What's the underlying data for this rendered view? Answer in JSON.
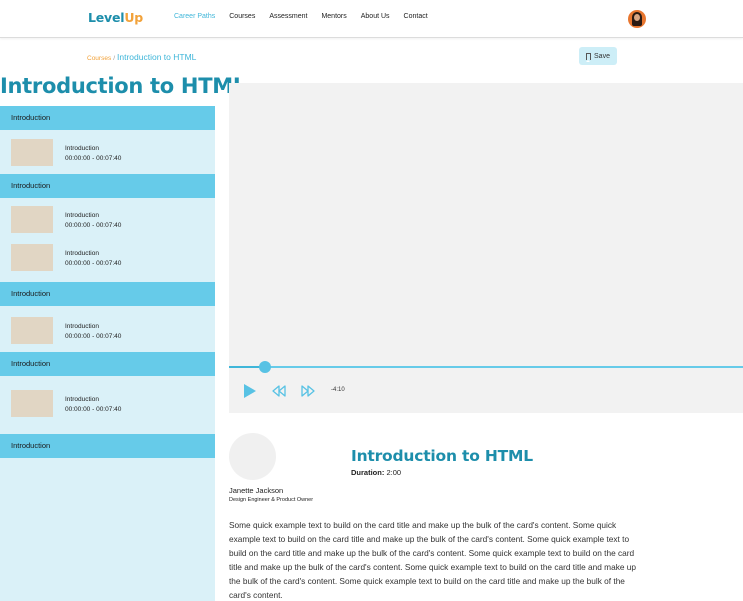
{
  "header": {
    "logo_part1": "Level",
    "logo_part2": "Up",
    "nav": [
      "Career Paths",
      "Courses",
      "Assessment",
      "Mentors",
      "About Us",
      "Contact"
    ],
    "active_nav": "Career Paths"
  },
  "breadcrumb": {
    "root": "Courses",
    "separator": "/",
    "current": "Introduction to HTML"
  },
  "save_label": "Save",
  "page_title": "Introduction to HTML",
  "sidebar": {
    "sections": [
      {
        "title": "Introduction",
        "lessons": [
          {
            "name": "Introduction",
            "time": "00:00:00 - 00:07:40"
          }
        ]
      },
      {
        "title": "Introduction",
        "lessons": [
          {
            "name": "Introduction",
            "time": "00:00:00 - 00:07:40"
          },
          {
            "name": "Introduction",
            "time": "00:00:00 - 00:07:40"
          }
        ]
      },
      {
        "title": "Introduction",
        "lessons": [
          {
            "name": "Introduction",
            "time": "00:00:00 - 00:07:40"
          }
        ]
      },
      {
        "title": "Introduction",
        "lessons": [
          {
            "name": "Introduction",
            "time": "00:00:00 - 00:07:40"
          }
        ]
      },
      {
        "title": "Introduction",
        "lessons": []
      }
    ]
  },
  "player": {
    "time_remaining": "-4:10",
    "progress": 0.07
  },
  "instructor": {
    "name": "Janette Jackson",
    "role": "Design Engineer & Product Owner"
  },
  "course": {
    "title": "Introduction to HTML",
    "duration_label": "Duration:",
    "duration_value": "2:00",
    "description": "Some quick example text to build on the card title and make up the bulk of the card's content. Some quick example text to build on the card title and make up the bulk of the card's content. Some quick example text to build on the card title and make up the bulk of the card's content. Some quick example text to build on the card title and make up the bulk of the card's content. Some quick example text to build on the card title and make up the bulk of the card's content. Some quick example text to build on the card title and make up the bulk of the card's content."
  },
  "colors": {
    "brand_blue": "#1d8eab",
    "brand_orange": "#f2a23a",
    "accent": "#3fb6d9",
    "section_header": "#66cbe9",
    "sidebar_bg": "#daf1f8"
  },
  "icons": {
    "save": "bookmark-icon",
    "play": "play-icon",
    "rewind": "rewind-icon",
    "forward": "fast-forward-icon"
  }
}
